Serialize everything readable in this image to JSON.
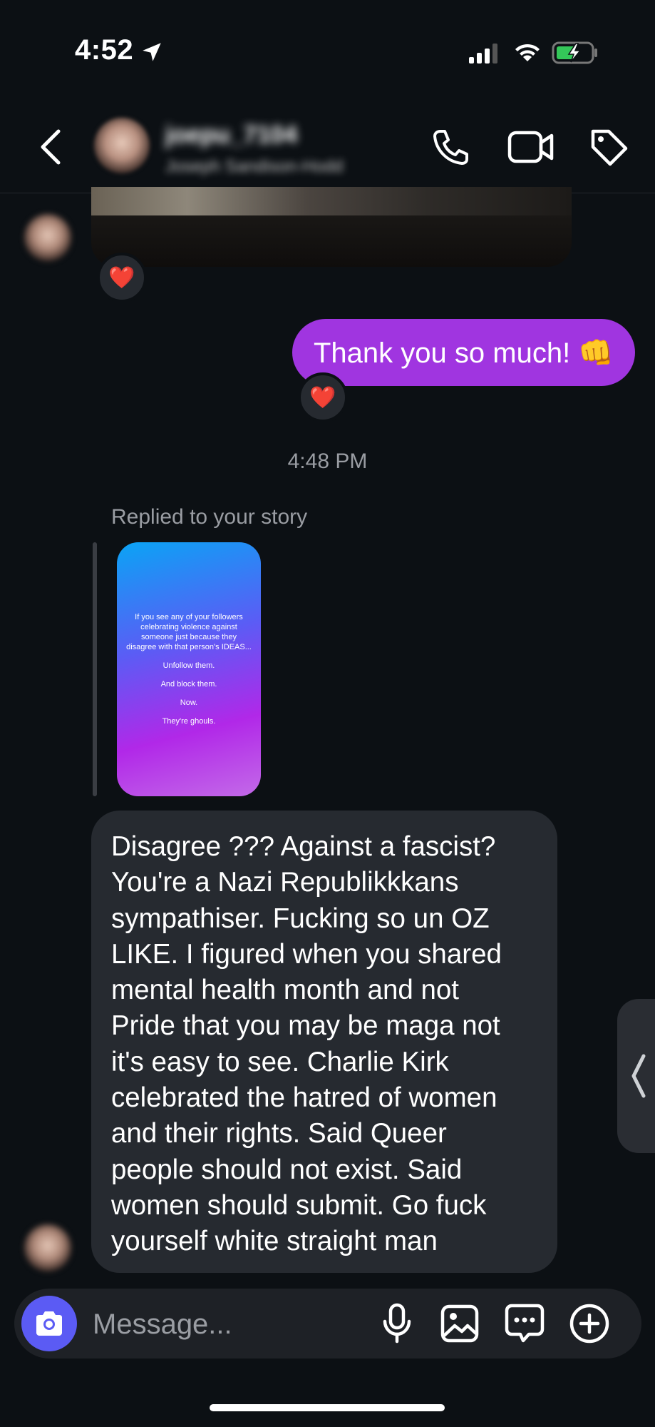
{
  "status_bar": {
    "time": "4:52"
  },
  "header": {
    "name": "joepu_7104",
    "subtitle": "Joseph Sandison-Hodd",
    "icons": [
      "back-icon",
      "call-icon",
      "video-icon",
      "tag-icon"
    ]
  },
  "thread": {
    "sent_message": "Thank you so much! 👊",
    "reaction": "❤️",
    "timestamp": "4:48 PM",
    "replied_label": "Replied to your story",
    "story_lines": [
      "If you see any of your followers celebrating violence against someone just because they disagree with that person's IDEAS...",
      "Unfollow them.",
      "And block them.",
      "Now.",
      "They're ghouls."
    ],
    "received_lines": [
      "Disagree ??? Against a fascist?",
      "You're a Nazi Republikkkans",
      "sympathiser. Fucking so un OZ",
      "LIKE. I figured when you shared",
      "mental health month and not",
      "Pride that you may be maga not",
      "it's easy to see. Charlie Kirk",
      "celebrated the hatred of women",
      "and their rights. Said Queer",
      "people should not exist. Said",
      "women should submit. Go fuck",
      "yourself white straight man"
    ]
  },
  "composer": {
    "placeholder": "Message..."
  },
  "side_handle": "❬",
  "colors": {
    "background": "#0c1014",
    "sent_bubble": "#a035e0",
    "received_bubble": "#262a30",
    "camera_button": "#5b5bf4"
  }
}
